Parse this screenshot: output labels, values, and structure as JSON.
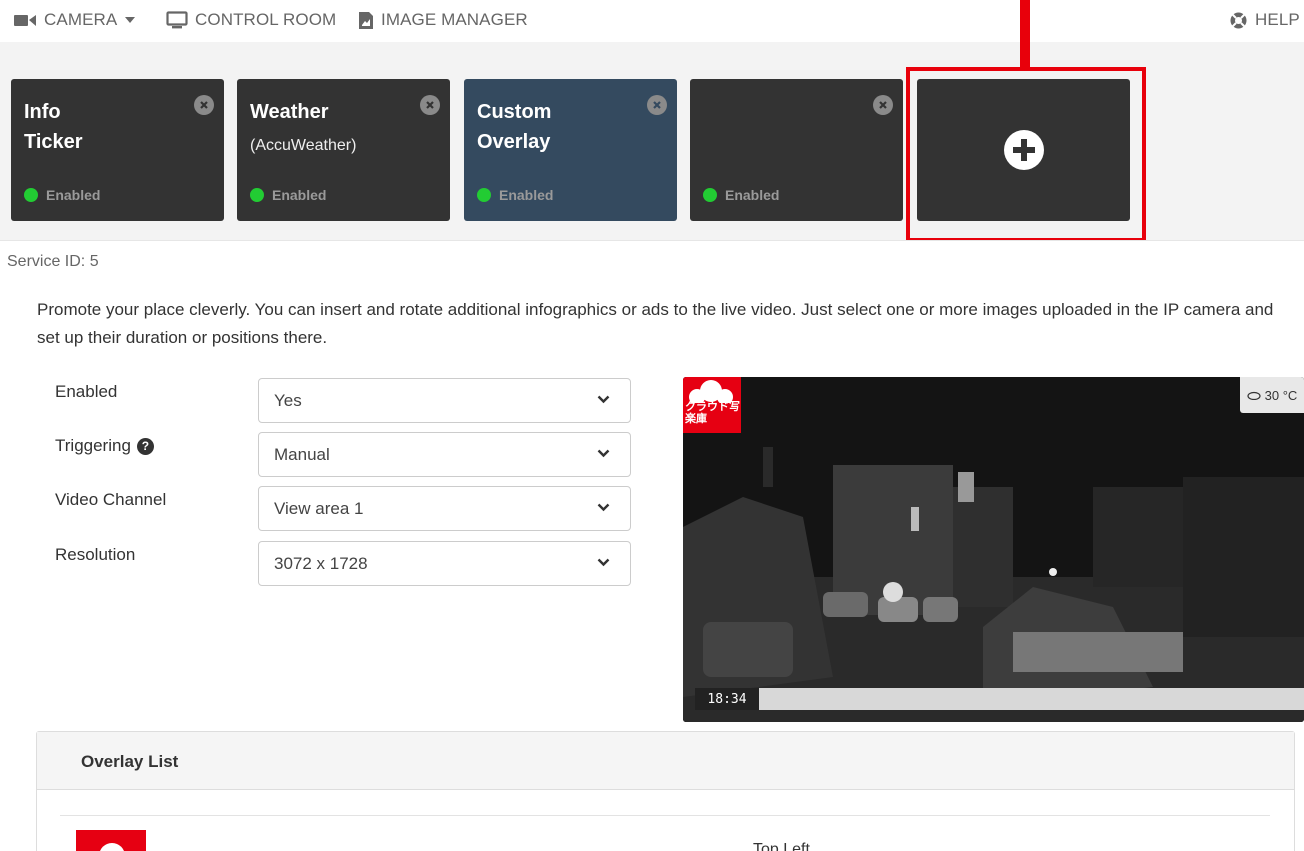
{
  "nav": {
    "camera": "CAMERA",
    "control_room": "CONTROL ROOM",
    "image_manager": "IMAGE MANAGER",
    "help": "HELP"
  },
  "tiles": [
    {
      "title_line1": "Info",
      "title_line2": "Ticker",
      "subtitle": "",
      "status": "Enabled",
      "active": false
    },
    {
      "title_line1": "Weather",
      "title_line2": "",
      "subtitle": "(AccuWeather)",
      "status": "Enabled",
      "active": false
    },
    {
      "title_line1": "Custom",
      "title_line2": "Overlay",
      "subtitle": "",
      "status": "Enabled",
      "active": true
    },
    {
      "title_line1": "",
      "title_line2": "",
      "subtitle": "",
      "status": "Enabled",
      "active": false
    }
  ],
  "colors": {
    "highlight": "#e8000b",
    "tile": "#333333",
    "tile_active": "#344a5f",
    "status_dot": "#22cc33",
    "logo_red": "#e60012"
  },
  "service": {
    "id_label": "Service ID: 5",
    "description": "Promote your place cleverly. You can insert and rotate additional infographics or ads to the live video. Just select one or more images uploaded in the IP camera and set up their duration or positions there."
  },
  "form": {
    "enabled": {
      "label": "Enabled",
      "value": "Yes"
    },
    "triggering": {
      "label": "Triggering",
      "value": "Manual"
    },
    "video_channel": {
      "label": "Video Channel",
      "value": "View area 1"
    },
    "resolution": {
      "label": "Resolution",
      "value": "3072 x 1728"
    }
  },
  "preview": {
    "logo_text": "クラウド写楽庫",
    "weather": "30 °C",
    "time": "18:34"
  },
  "overlay_list": {
    "title": "Overlay List",
    "rows": [
      {
        "position": "Top Left"
      }
    ]
  }
}
